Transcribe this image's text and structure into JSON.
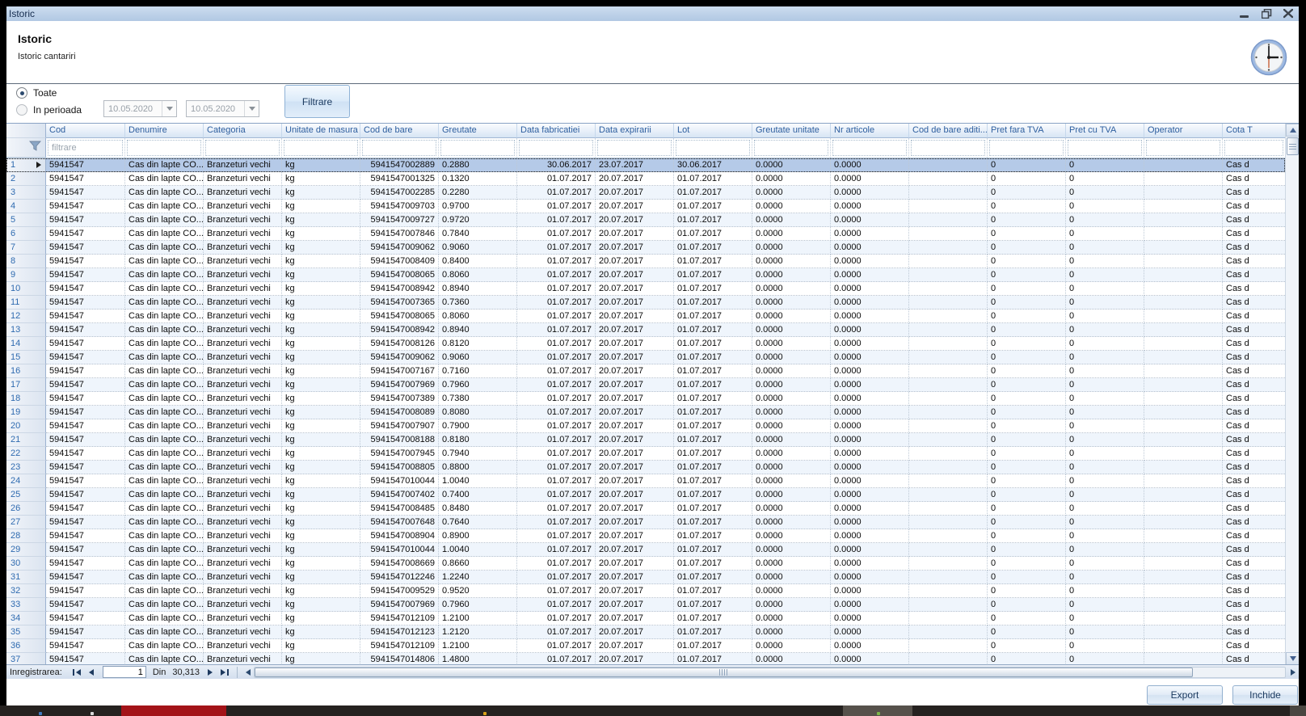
{
  "window": {
    "title": "Istoric",
    "controls": {
      "minimize": "minimize",
      "restore": "restore",
      "close": "close"
    }
  },
  "header": {
    "title": "Istoric",
    "subtitle": "Istoric cantariri"
  },
  "filters": {
    "radio_all": "Toate",
    "radio_period": "In perioada",
    "date_from": "10.05.2020",
    "date_to": "10.05.2020",
    "filter_button": "Filtrare"
  },
  "grid": {
    "filter_placeholder": "filtrare",
    "selected_row_index": 0,
    "columns": [
      {
        "key": "cod",
        "label": "Cod"
      },
      {
        "key": "denumire",
        "label": "Denumire"
      },
      {
        "key": "categoria",
        "label": "Categoria"
      },
      {
        "key": "unitate-de-masura",
        "label": "Unitate de masura"
      },
      {
        "key": "cod-de-bare",
        "label": "Cod de bare"
      },
      {
        "key": "greutate",
        "label": "Greutate"
      },
      {
        "key": "data-fabricatiei",
        "label": "Data fabricatiei"
      },
      {
        "key": "data-expirarii",
        "label": "Data expirarii"
      },
      {
        "key": "lot",
        "label": "Lot"
      },
      {
        "key": "greutate-unitate",
        "label": "Greutate unitate"
      },
      {
        "key": "nr-articole",
        "label": "Nr articole"
      },
      {
        "key": "cod-de-bare-aditional",
        "label": "Cod de bare aditi..."
      },
      {
        "key": "pret-fara-tva",
        "label": "Pret fara TVA"
      },
      {
        "key": "pret-cu-tva",
        "label": "Pret cu TVA"
      },
      {
        "key": "operator",
        "label": "Operator"
      },
      {
        "key": "cota",
        "label": "Cota T"
      }
    ],
    "row_defaults": {
      "cod": "5941547",
      "denumire": "Cas din lapte CO...",
      "categoria": "Branzeturi vechi",
      "um": "kg",
      "data_fabricatiei": "01.07.2017",
      "data_expirarii": "20.07.2017",
      "lot": "01.07.2017",
      "greutate_unitate": "0.0000",
      "nr_articole": "0.0000",
      "cod_bare_aditional": "",
      "pret_fara_tva": "0",
      "pret_cu_tva": "0",
      "operator": "",
      "cota": "Cas d"
    },
    "rows": [
      [
        1,
        "5941547002889",
        "0.2880",
        "30.06.2017",
        "23.07.2017",
        "30.06.2017"
      ],
      [
        2,
        "5941547001325",
        "0.1320"
      ],
      [
        3,
        "5941547002285",
        "0.2280"
      ],
      [
        4,
        "5941547009703",
        "0.9700"
      ],
      [
        5,
        "5941547009727",
        "0.9720"
      ],
      [
        6,
        "5941547007846",
        "0.7840"
      ],
      [
        7,
        "5941547009062",
        "0.9060"
      ],
      [
        8,
        "5941547008409",
        "0.8400"
      ],
      [
        9,
        "5941547008065",
        "0.8060"
      ],
      [
        10,
        "5941547008942",
        "0.8940"
      ],
      [
        11,
        "5941547007365",
        "0.7360"
      ],
      [
        12,
        "5941547008065",
        "0.8060"
      ],
      [
        13,
        "5941547008942",
        "0.8940"
      ],
      [
        14,
        "5941547008126",
        "0.8120"
      ],
      [
        15,
        "5941547009062",
        "0.9060"
      ],
      [
        16,
        "5941547007167",
        "0.7160"
      ],
      [
        17,
        "5941547007969",
        "0.7960"
      ],
      [
        18,
        "5941547007389",
        "0.7380"
      ],
      [
        19,
        "5941547008089",
        "0.8080"
      ],
      [
        20,
        "5941547007907",
        "0.7900"
      ],
      [
        21,
        "5941547008188",
        "0.8180"
      ],
      [
        22,
        "5941547007945",
        "0.7940"
      ],
      [
        23,
        "5941547008805",
        "0.8800"
      ],
      [
        24,
        "5941547010044",
        "1.0040"
      ],
      [
        25,
        "5941547007402",
        "0.7400"
      ],
      [
        26,
        "5941547008485",
        "0.8480"
      ],
      [
        27,
        "5941547007648",
        "0.7640"
      ],
      [
        28,
        "5941547008904",
        "0.8900"
      ],
      [
        29,
        "5941547010044",
        "1.0040"
      ],
      [
        30,
        "5941547008669",
        "0.8660"
      ],
      [
        31,
        "5941547012246",
        "1.2240"
      ],
      [
        32,
        "5941547009529",
        "0.9520"
      ],
      [
        33,
        "5941547007969",
        "0.7960"
      ],
      [
        34,
        "5941547012109",
        "1.2100"
      ],
      [
        35,
        "5941547012123",
        "1.2120"
      ],
      [
        36,
        "5941547012109",
        "1.2100"
      ],
      [
        37,
        "5941547014806",
        "1.4800"
      ]
    ]
  },
  "record_nav": {
    "label": "Inregistrarea:",
    "current": "1",
    "of_label": "Din",
    "total": "30,313"
  },
  "footer_buttons": {
    "export": "Export",
    "close": "Inchide"
  },
  "colors": {
    "titlebar": "#b9cfe8",
    "selected_row": "#b5cae8",
    "header_text": "#2d5e9e",
    "taskbar_red": "#a31318"
  }
}
